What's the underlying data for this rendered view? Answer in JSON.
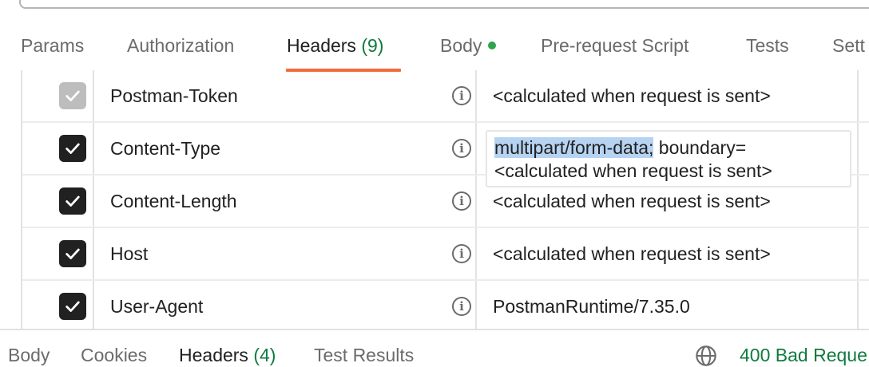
{
  "tabs": [
    {
      "label": "Params"
    },
    {
      "label": "Authorization"
    },
    {
      "label": "Headers",
      "count": "(9)"
    },
    {
      "label": "Body"
    },
    {
      "label": "Pre-request Script"
    },
    {
      "label": "Tests"
    },
    {
      "label": "Sett"
    }
  ],
  "active_tab": "Headers",
  "headers": [
    {
      "key": "Postman-Token",
      "value": "<calculated when request is sent>",
      "checked": true,
      "disabled": true
    },
    {
      "key": "Content-Type",
      "value_selected": "multipart/form-data;",
      "value_rest": " boundary=",
      "value_line2": "<calculated when request is sent>",
      "checked": true
    },
    {
      "key": "Content-Length",
      "value": "<calculated when request is sent>",
      "checked": true
    },
    {
      "key": "Host",
      "value": "<calculated when request is sent>",
      "checked": true
    },
    {
      "key": "User-Agent",
      "value": "PostmanRuntime/7.35.0",
      "checked": true
    }
  ],
  "info_icon": "i",
  "response_tabs": [
    {
      "label": "Body"
    },
    {
      "label": "Cookies"
    },
    {
      "label": "Headers",
      "count": "(4)"
    },
    {
      "label": "Test Results"
    }
  ],
  "response_status": "400 Bad Reque",
  "colors": {
    "accent": "#f26b3a",
    "success": "#0f7b3e",
    "selection": "#b6d3f2"
  }
}
